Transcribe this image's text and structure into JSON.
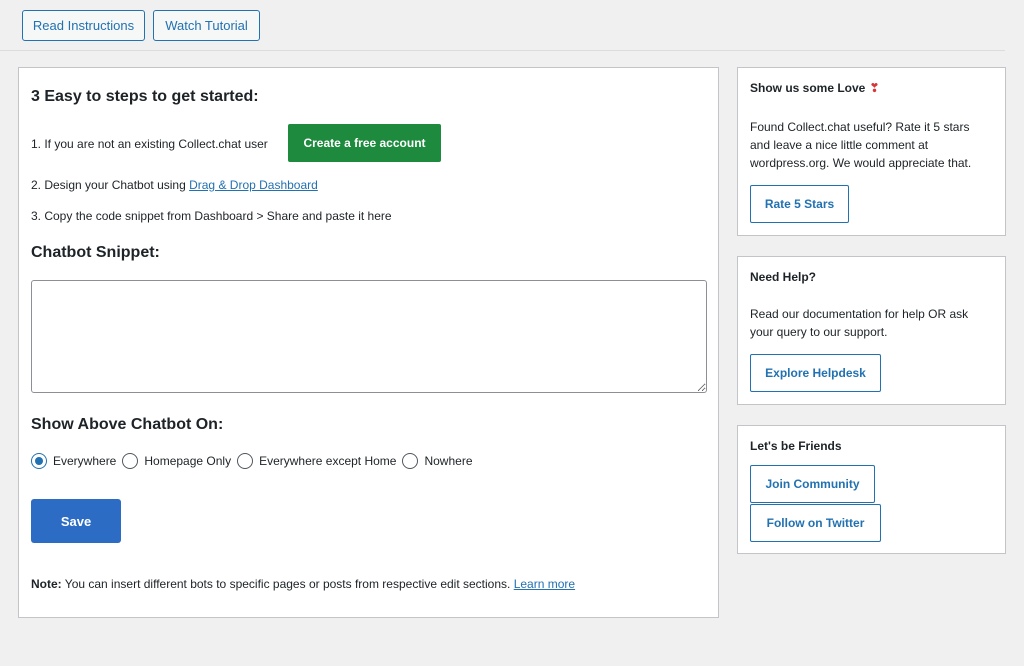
{
  "toolbar": {
    "read_instructions": "Read Instructions",
    "watch_tutorial": "Watch Tutorial"
  },
  "main": {
    "steps_title": "3 Easy to steps to get started:",
    "step1_text": "1. If you are not an existing Collect.chat user",
    "create_account_label": "Create a free account",
    "step2_prefix": "2. Design your Chatbot using ",
    "step2_link": "Drag & Drop Dashboard",
    "step3_text": "3. Copy the code snippet from Dashboard > Share and paste it here",
    "snippet_title": "Chatbot Snippet:",
    "snippet_value": "",
    "show_title": "Show Above Chatbot On:",
    "radio_options": [
      "Everywhere",
      "Homepage Only",
      "Everywhere except Home",
      "Nowhere"
    ],
    "selected_option": "Everywhere",
    "save_label": "Save",
    "note_label": "Note:",
    "note_text": " You can insert different bots to specific pages or posts from respective edit sections. ",
    "note_link": "Learn more"
  },
  "sidebar": {
    "love": {
      "title": "Show us some Love",
      "heart_icon": "heart-icon",
      "text": "Found Collect.chat useful? Rate it 5 stars and leave a nice little comment at wordpress.org. We would appreciate that.",
      "button": "Rate 5 Stars"
    },
    "help": {
      "title": "Need Help?",
      "text": "Read our documentation for help OR ask your query to our support.",
      "button": "Explore Helpdesk"
    },
    "friends": {
      "title": "Let's be Friends",
      "join_button": "Join Community",
      "twitter_button": "Follow on Twitter"
    }
  },
  "colors": {
    "accent": "#2271b1",
    "save_bg": "#2c6cc5",
    "create_bg": "#1e8a3e",
    "heart": "#d63638",
    "page_bg": "#f0f0f1"
  }
}
